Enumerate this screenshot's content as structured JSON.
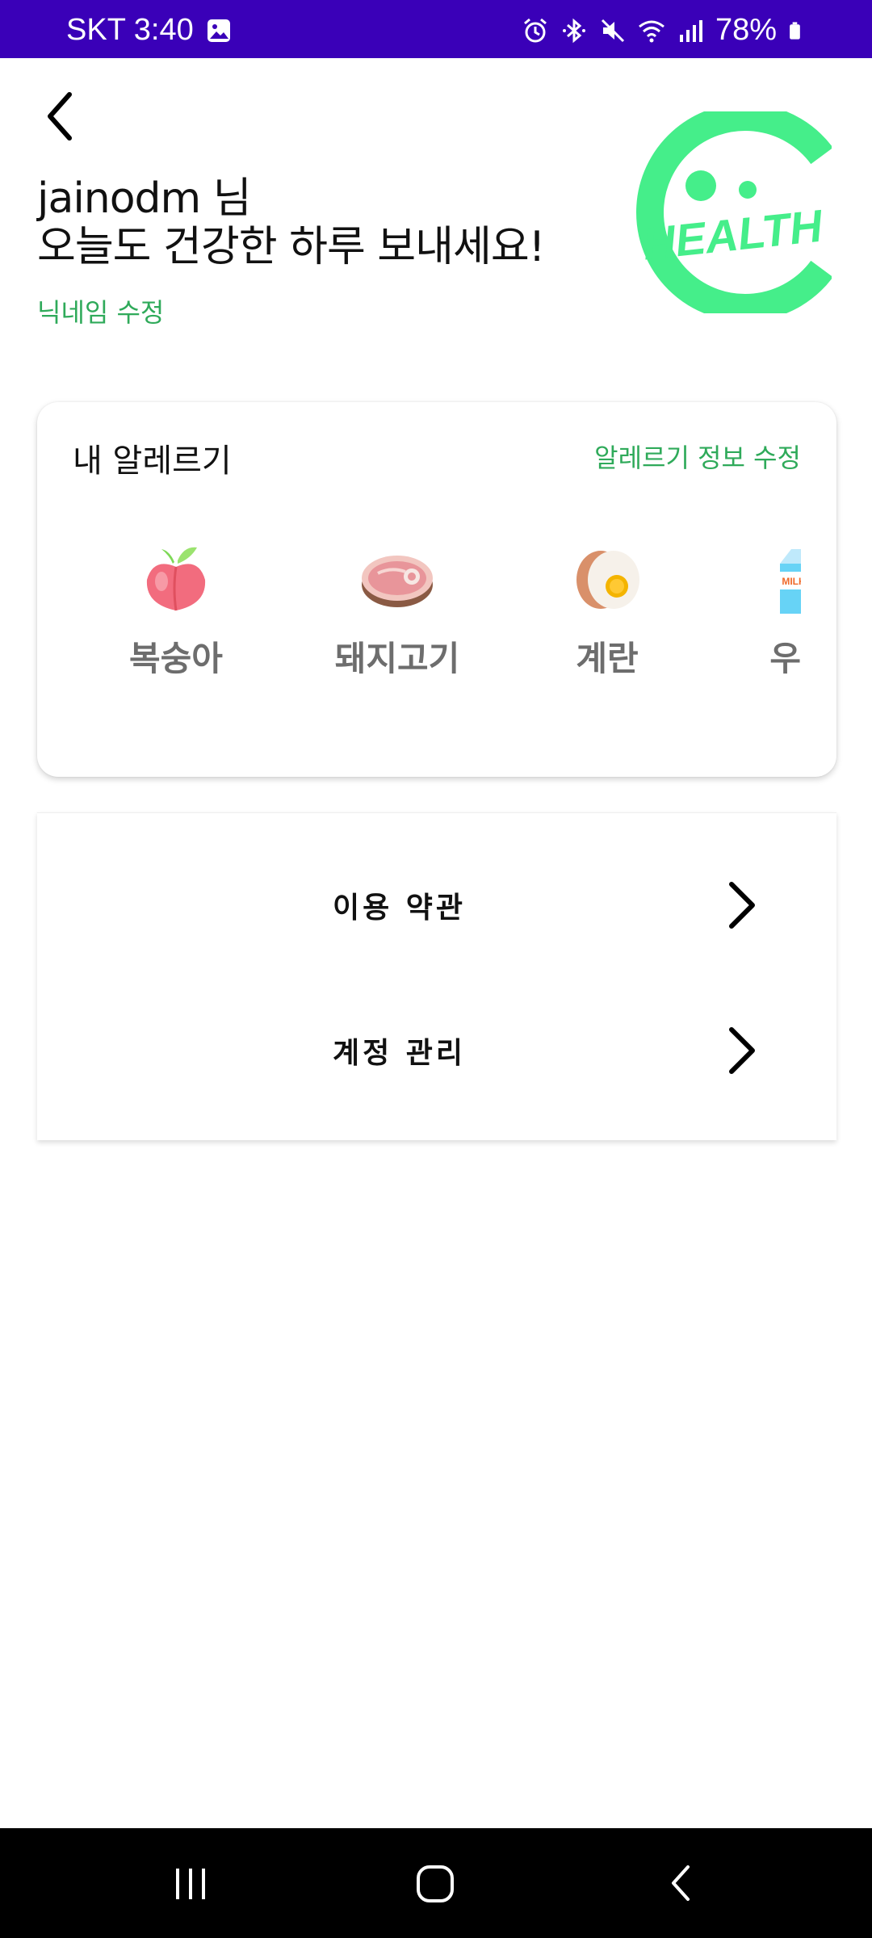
{
  "status_bar": {
    "carrier_time": "SKT 3:40",
    "battery": "78%",
    "icons": [
      "gallery-icon",
      "alarm-icon",
      "bluetooth-icon",
      "mute-icon",
      "wifi-icon",
      "signal-icon",
      "battery-icon"
    ]
  },
  "header": {
    "greeting_line1": "jainodm 님",
    "greeting_line2": "오늘도 건강한 하루 보내세요!",
    "edit_nickname": "닉네임 수정",
    "logo_text": "HEALTH"
  },
  "allergy": {
    "title": "내 알레르기",
    "edit_label": "알레르기 정보 수정",
    "items": [
      {
        "label": "복숭아",
        "icon": "peach-icon"
      },
      {
        "label": "돼지고기",
        "icon": "pork-icon"
      },
      {
        "label": "계란",
        "icon": "egg-icon"
      },
      {
        "label": "우유",
        "icon": "milk-icon",
        "milk_text": "MILK"
      }
    ]
  },
  "menu": {
    "items": [
      {
        "label": "이용 약관"
      },
      {
        "label": "계정 관리"
      }
    ]
  },
  "colors": {
    "status_bar": "#3a00b8",
    "accent_green": "#2faa5a",
    "logo_green": "#45ee8a",
    "label_gray": "#6d6d6d"
  }
}
